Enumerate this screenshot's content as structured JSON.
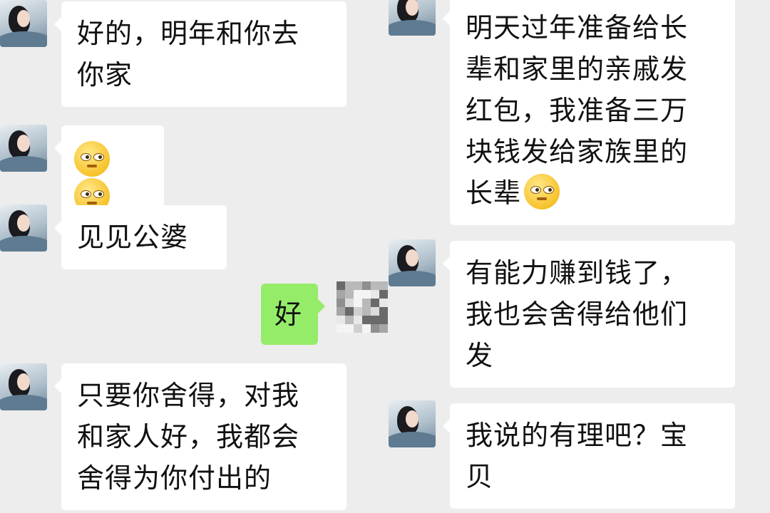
{
  "chat": {
    "left_column": [
      {
        "id": "msg1",
        "lines": [
          "好的，明年和你去",
          "你家"
        ]
      },
      {
        "id": "msg2",
        "emoji": [
          "grinning-face-icon",
          "grinning-face-icon"
        ]
      },
      {
        "id": "msg3",
        "lines": [
          "见见公婆"
        ]
      },
      {
        "id": "msg4",
        "sent": true,
        "lines": [
          "好"
        ]
      },
      {
        "id": "msg5",
        "lines": [
          "只要你舍得，对我",
          "和家人好，我都会",
          "舍得为你付出的"
        ]
      }
    ],
    "right_column": [
      {
        "id": "msg6",
        "lines": [
          "明天过年准备给长",
          "辈和家里的亲戚发",
          "红包，我准备三万",
          "块钱发给家族里的",
          "长辈"
        ],
        "trailing_emoji": "grinning-face-icon"
      },
      {
        "id": "msg7",
        "lines": [
          "有能力赚到钱了，",
          "我也会舍得给他们",
          "发"
        ]
      },
      {
        "id": "msg8",
        "lines": [
          "我说的有理吧？宝",
          "贝"
        ]
      }
    ]
  },
  "colors": {
    "background": "#ededed",
    "received_bubble": "#ffffff",
    "sent_bubble": "#95ec69"
  }
}
